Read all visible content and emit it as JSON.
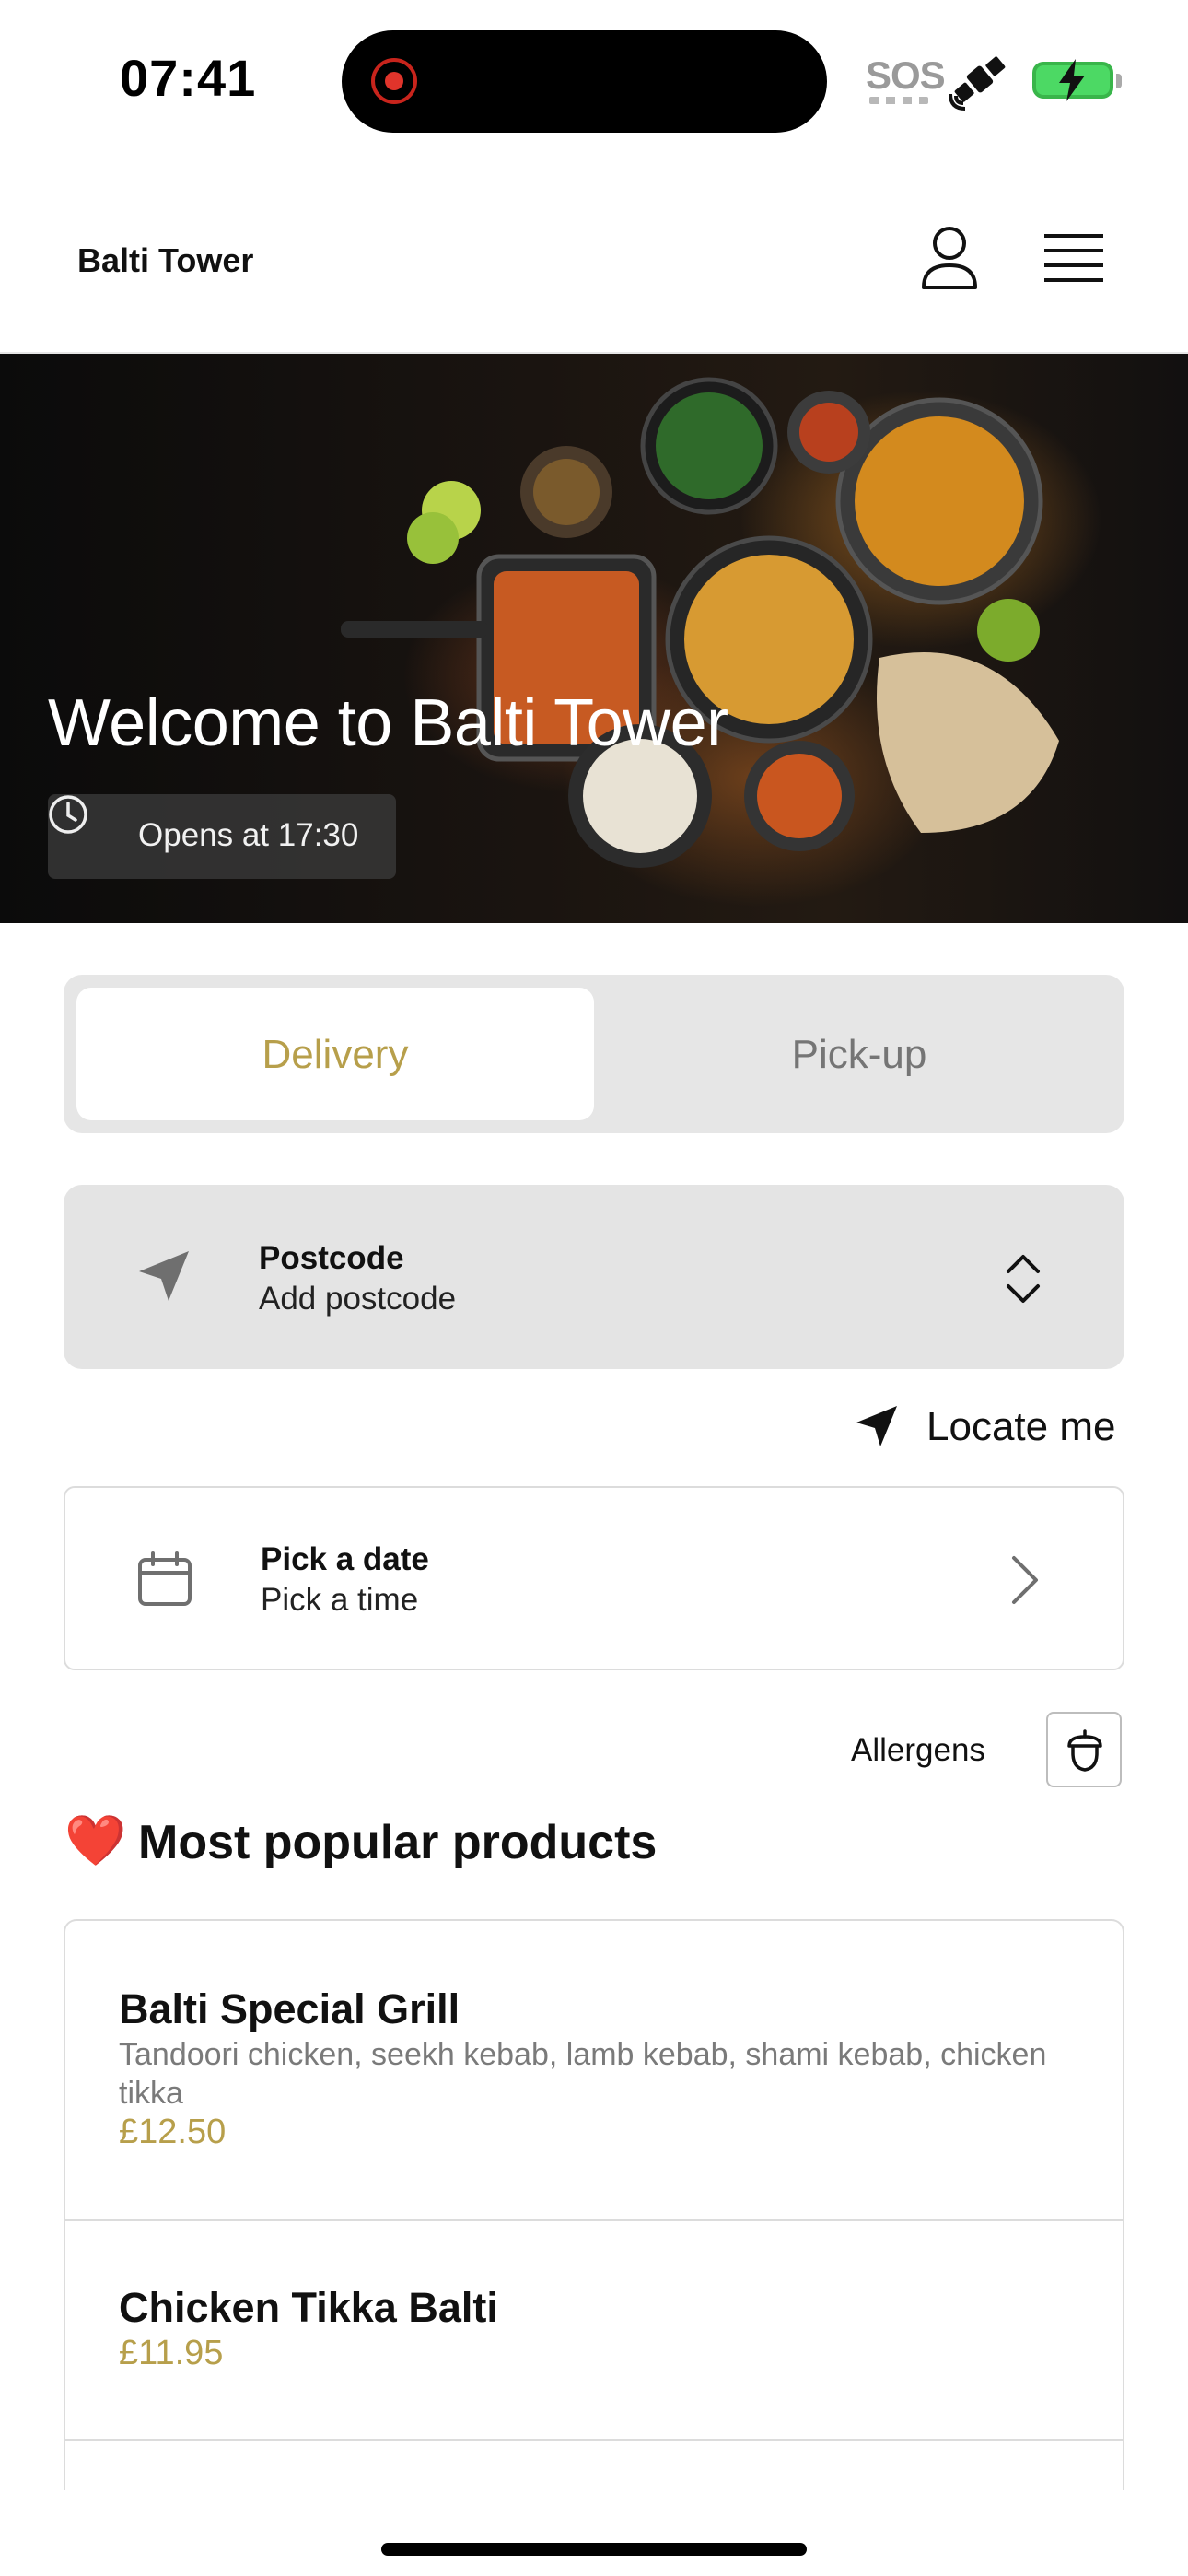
{
  "status_bar": {
    "time": "07:41",
    "sos": "SOS",
    "icons": [
      "recording-indicator-icon",
      "satellite-icon",
      "battery-charging-icon"
    ],
    "battery_color": "#4cd964"
  },
  "header": {
    "brand": "Balti Tower",
    "icons": [
      "user-icon",
      "menu-icon"
    ]
  },
  "hero": {
    "title": "Welcome to Balti Tower",
    "hours": "Opens at 17:30",
    "hours_icon": "clock-icon"
  },
  "mode_toggle": {
    "options": [
      "Delivery",
      "Pick-up"
    ],
    "selected": "Delivery",
    "accent_color": "#b79f4b"
  },
  "postcode": {
    "title": "Postcode",
    "placeholder": "Add postcode",
    "icon": "navigation-arrow-icon"
  },
  "locate": {
    "label": "Locate me",
    "icon": "location-arrow-icon"
  },
  "schedule": {
    "title": "Pick a date",
    "subtitle": "Pick a time",
    "icon": "calendar-icon"
  },
  "allergens": {
    "label": "Allergens",
    "icon": "acorn-icon"
  },
  "popular": {
    "emoji": "❤️",
    "title": "Most popular products",
    "products": [
      {
        "name": "Balti Special Grill",
        "description": "Tandoori chicken, seekh kebab, lamb kebab, shami kebab, chicken tikka",
        "price": "£12.50"
      },
      {
        "name": "Chicken Tikka Balti",
        "description": "",
        "price": "£11.95"
      }
    ]
  }
}
